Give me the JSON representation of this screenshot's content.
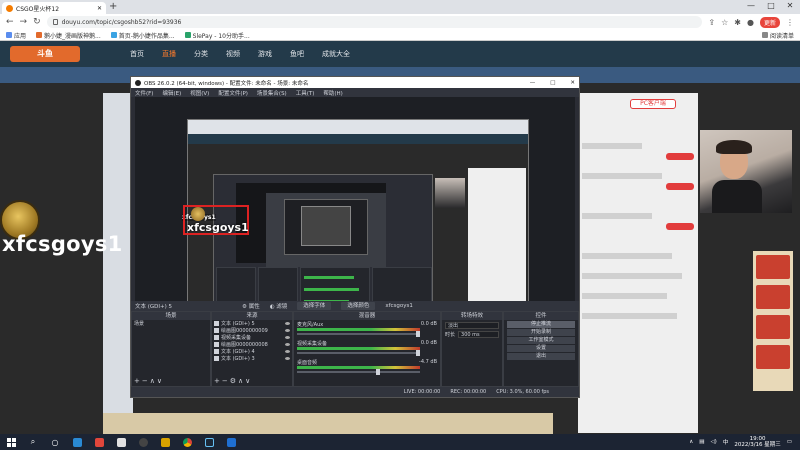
{
  "browser": {
    "tab_title": "CSGO星火杯12",
    "url": "douyu.com/topic/csgoshb52?rid=93936",
    "profile_button": "更新",
    "bookmarks": [
      "应用",
      "鹅小婕_漫画版神鹅...",
      "首页-鹅小婕作品集...",
      "SlePay - 10分助手..."
    ],
    "bookmarks_right": "阅读清单"
  },
  "douyu": {
    "logo": "斗鱼",
    "nav": [
      "首页",
      "直播",
      "分类",
      "视频",
      "游戏",
      "鱼吧",
      "成就大全"
    ],
    "pc_client_badge": "PC客户端"
  },
  "stream_overlay": {
    "viewer_name": "xfcsgoys1"
  },
  "obs": {
    "title": "OBS 26.0.2 (64-bit, windows) - 配置文件: 未命名 - 场景: 未命名",
    "menu": [
      "文件(F)",
      "编辑(E)",
      "视图(V)",
      "配置文件(P)",
      "场景集合(S)",
      "工具(T)",
      "帮助(H)"
    ],
    "selected_source_label": "文本 (GDI+) 5",
    "toolbar_buttons": [
      "属性",
      "滤镜",
      "选择字体",
      "选择颜色"
    ],
    "font_preview": "xfcsgoys1",
    "docks": {
      "scenes": {
        "title": "场景",
        "items": [
          "场景"
        ]
      },
      "sources": {
        "title": "来源",
        "items": [
          "文本 (GDI+) 5",
          "绘画图0000000009",
          "视频采集设备",
          "绘画图0000000008",
          "文本 (GDI+) 4",
          "文本 (GDI+) 3"
        ]
      },
      "mixer": {
        "title": "混音器",
        "channels": [
          {
            "name": "麦克风/Aux",
            "db": "0.0 dB"
          },
          {
            "name": "视频采集设备",
            "db": "0.0 dB"
          },
          {
            "name": "桌面音频",
            "db": "-4.7 dB"
          }
        ]
      },
      "transitions": {
        "title": "转场特效",
        "type": "淡出",
        "duration_label": "时长",
        "duration": "300 ms"
      },
      "controls": {
        "title": "控件",
        "buttons": [
          "停止推流",
          "开始录制",
          "工作室模式",
          "设置",
          "退出"
        ]
      }
    },
    "status": {
      "live": "LIVE: 00:00:00",
      "rec": "REC: 00:00:00",
      "cpu": "CPU: 3.0%, 60.00 fps"
    }
  },
  "taskbar": {
    "time": "19:00",
    "date": "2022/3/16 星期三"
  }
}
